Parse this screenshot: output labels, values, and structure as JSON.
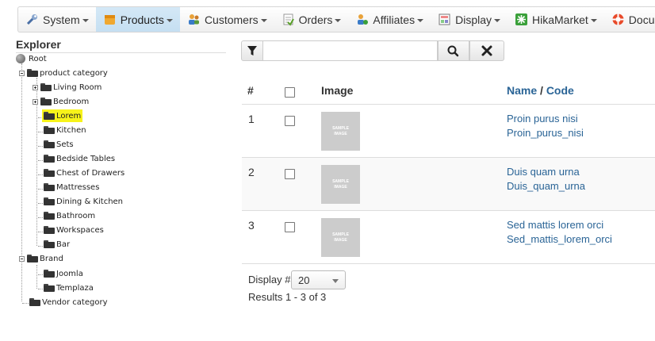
{
  "menu": {
    "items": [
      {
        "label": "System",
        "icon": "wrench-icon"
      },
      {
        "label": "Products",
        "icon": "box-icon",
        "active": true
      },
      {
        "label": "Customers",
        "icon": "users-icon"
      },
      {
        "label": "Orders",
        "icon": "orders-icon"
      },
      {
        "label": "Affiliates",
        "icon": "affiliates-icon"
      },
      {
        "label": "Display",
        "icon": "display-icon"
      },
      {
        "label": "HikaMarket",
        "icon": "hikamarket-icon"
      },
      {
        "label": "Docu",
        "icon": "help-lifebuoy-icon"
      }
    ]
  },
  "explorer": {
    "title": "Explorer",
    "root": "Root",
    "product_category": "product category",
    "categories": [
      "Living Room",
      "Bedroom",
      "Lorem",
      "Kitchen",
      "Sets",
      "Bedside Tables",
      "Chest of Drawers",
      "Mattresses",
      "Dining & Kitchen",
      "Bathroom",
      "Workspaces",
      "Bar"
    ],
    "brand": "Brand",
    "brands": [
      "Joomla",
      "Templaza"
    ],
    "vendor_category": "Vendor category"
  },
  "search": {
    "value": "",
    "placeholder": ""
  },
  "table": {
    "headers": {
      "num": "#",
      "image": "Image",
      "name": "Name",
      "sep": " / ",
      "code": "Code"
    },
    "image_placeholder": "SAMPLE IMAGE",
    "rows": [
      {
        "num": "1",
        "name": "Proin purus nisi",
        "code": "Proin_purus_nisi"
      },
      {
        "num": "2",
        "name": "Duis quam urna",
        "code": "Duis_quam_urna"
      },
      {
        "num": "3",
        "name": "Sed mattis lorem orci",
        "code": "Sed_mattis_lorem_orci"
      }
    ]
  },
  "pagination": {
    "display_label": "Display #",
    "display_value": "20",
    "results": "Results 1 - 3 of 3"
  },
  "colors": {
    "link": "#2a6496",
    "highlight": "#f7f31a",
    "active_menu": "#c5dff2"
  }
}
